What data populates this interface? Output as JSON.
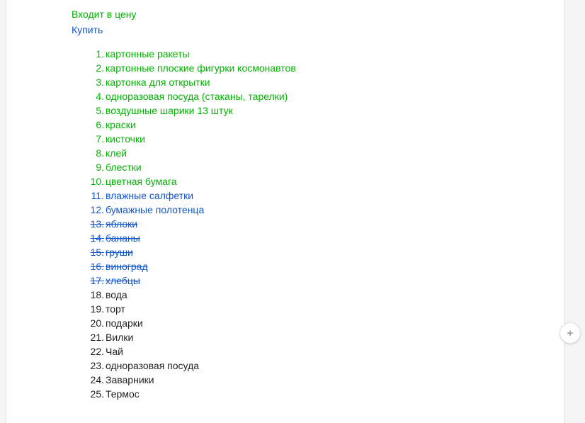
{
  "headings": {
    "included": "Входит в цену",
    "buy": "Купить"
  },
  "items": [
    {
      "text": "картонные ракеты",
      "color": "green",
      "strike": false
    },
    {
      "text": "картонные плоские фигурки космонавтов",
      "color": "green",
      "strike": false
    },
    {
      "text": "картонка для открытки",
      "color": "green",
      "strike": false
    },
    {
      "text": "одноразовая посуда (стаканы, тарелки)",
      "color": "green",
      "strike": false
    },
    {
      "text": "воздушные шарики 13 штук",
      "color": "green",
      "strike": false
    },
    {
      "text": "краски",
      "color": "green",
      "strike": false
    },
    {
      "text": "кисточки",
      "color": "green",
      "strike": false
    },
    {
      "text": "клей",
      "color": "green",
      "strike": false
    },
    {
      "text": "блестки",
      "color": "green",
      "strike": false
    },
    {
      "text": "цветная бумага",
      "color": "green",
      "strike": false
    },
    {
      "text": "влажные салфетки",
      "color": "blue",
      "strike": false
    },
    {
      "text": "бумажные полотенца",
      "color": "blue",
      "strike": false
    },
    {
      "text": "яблоки",
      "color": "blue",
      "strike": true
    },
    {
      "text": "бананы",
      "color": "blue",
      "strike": true
    },
    {
      "text": "груши",
      "color": "blue",
      "strike": true
    },
    {
      "text": "виноград",
      "color": "blue",
      "strike": true
    },
    {
      "text": "хлебцы",
      "color": "blue",
      "strike": true
    },
    {
      "text": "вода",
      "color": "black",
      "strike": false
    },
    {
      "text": "торт",
      "color": "black",
      "strike": false
    },
    {
      "text": "подарки",
      "color": "black",
      "strike": false
    },
    {
      "text": "Вилки",
      "color": "black",
      "strike": false
    },
    {
      "text": "Чай",
      "color": "black",
      "strike": false
    },
    {
      "text": "одноразовая посуда",
      "color": "black",
      "strike": false
    },
    {
      "text": "Заварники",
      "color": "black",
      "strike": false
    },
    {
      "text": "Термос",
      "color": "black",
      "strike": false
    }
  ],
  "fab": {
    "symbol": "+"
  }
}
